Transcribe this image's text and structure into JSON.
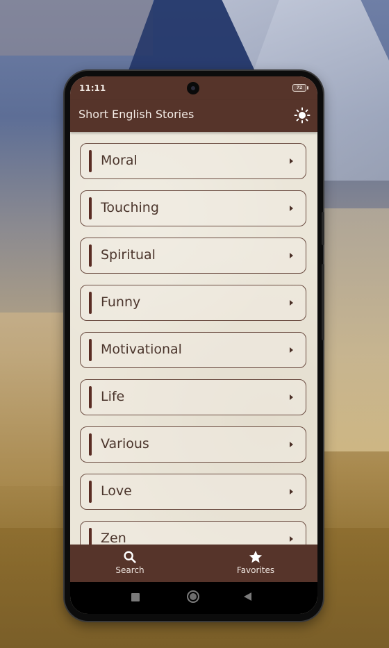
{
  "status_bar": {
    "time": "11:11",
    "battery": "72"
  },
  "app_bar": {
    "title": "Short English Stories",
    "theme_toggle_icon": "sun-icon"
  },
  "categories": [
    {
      "label": "Moral"
    },
    {
      "label": "Touching"
    },
    {
      "label": "Spiritual"
    },
    {
      "label": "Funny"
    },
    {
      "label": "Motivational"
    },
    {
      "label": "Life"
    },
    {
      "label": "Various"
    },
    {
      "label": "Love"
    },
    {
      "label": "Zen"
    }
  ],
  "bottom_nav": {
    "items": [
      {
        "label": "Search",
        "icon": "search-icon"
      },
      {
        "label": "Favorites",
        "icon": "star-icon"
      }
    ]
  },
  "system_nav": {
    "buttons": [
      "recents",
      "home",
      "back"
    ]
  },
  "colors": {
    "primary": "#56342a",
    "accent_bar": "#5a2d24",
    "background": "#ebe6d9",
    "text": "#4b352c"
  }
}
